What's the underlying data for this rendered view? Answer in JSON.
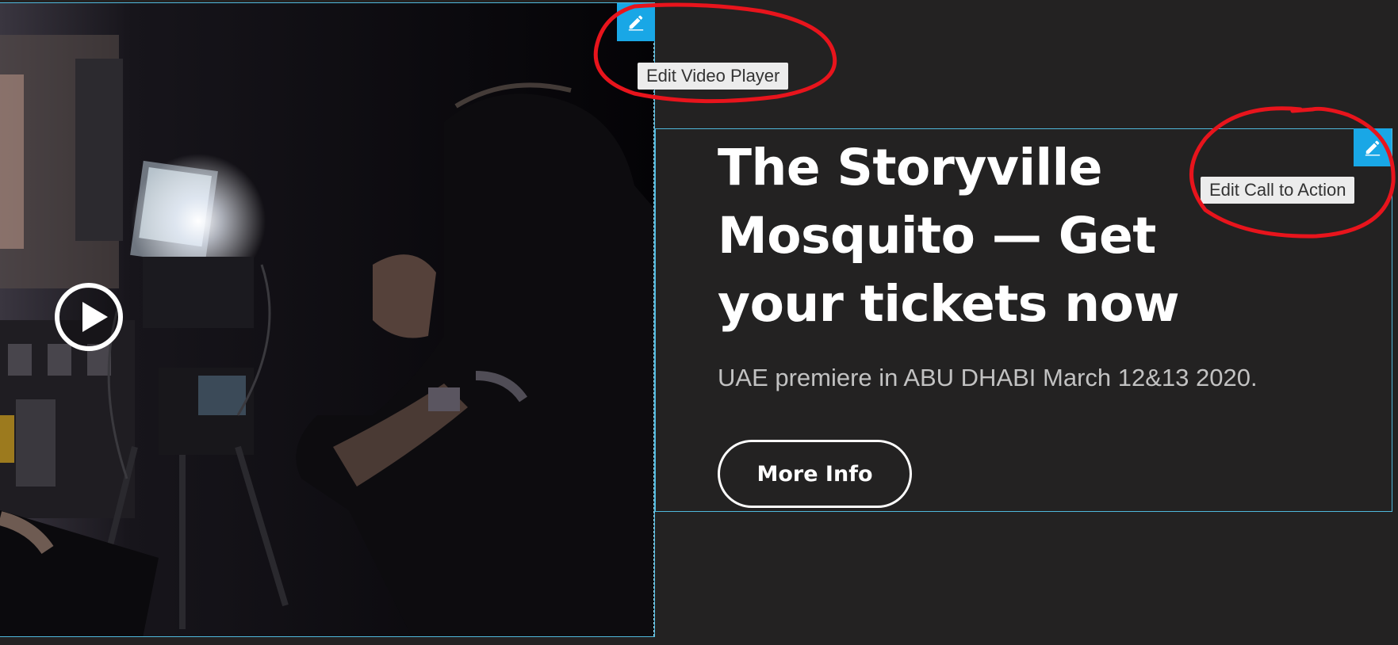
{
  "video_player": {
    "edit_tooltip": "Edit Video Player",
    "play_icon": "play-icon",
    "edit_icon": "pencil-icon"
  },
  "call_to_action": {
    "edit_tooltip": "Edit Call to Action",
    "title": "The Storyville Mosquito — Get your tickets now",
    "description": "UAE premiere in ABU DHABI March 12&13 2020.",
    "button_label": "More Info",
    "edit_icon": "pencil-icon"
  },
  "colors": {
    "background": "#232222",
    "selection_border": "#4fb8dc",
    "edit_handle": "#19a7e6",
    "annotation_red": "#e8141c"
  }
}
